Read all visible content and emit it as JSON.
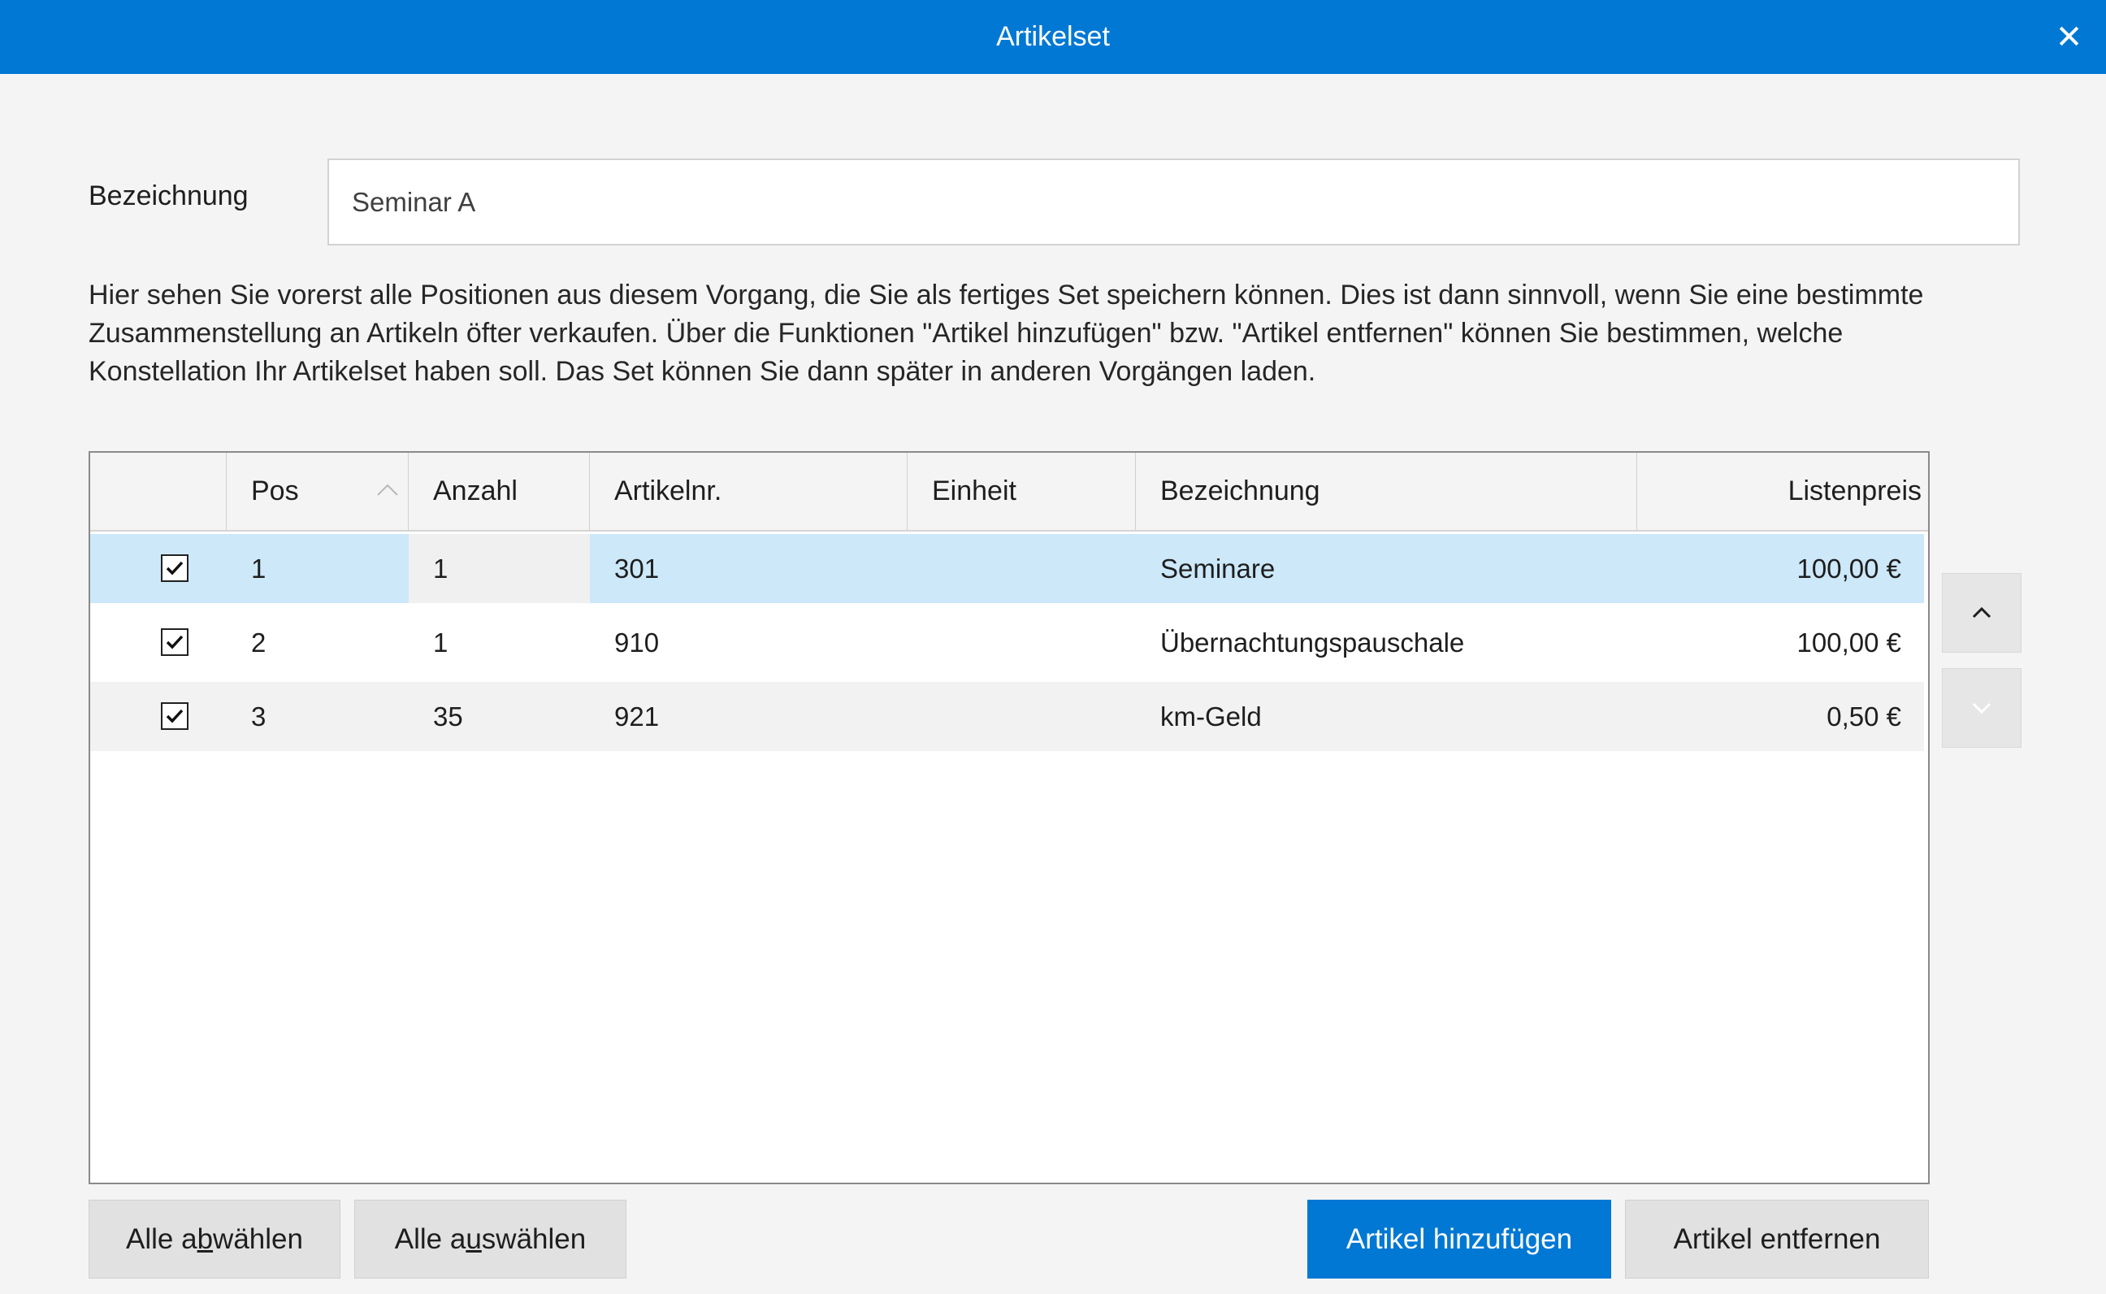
{
  "window": {
    "title": "Artikelset",
    "close_glyph": "✕"
  },
  "name_field": {
    "label": "Bezeichnung",
    "value": "Seminar A"
  },
  "description": "Hier sehen Sie vorerst alle Positionen aus diesem Vorgang, die Sie als fertiges Set speichern können. Dies ist dann sinnvoll, wenn Sie eine bestimmte Zusammenstellung an Artikeln öfter verkaufen. Über die Funktionen \"Artikel hinzufügen\" bzw. \"Artikel entfernen\" können Sie bestimmen, welche Konstellation Ihr Artikelset haben soll. Das Set können Sie dann später in anderen Vorgängen laden.",
  "table": {
    "columns": {
      "pos": "Pos",
      "anzahl": "Anzahl",
      "artikelnr": "Artikelnr.",
      "einheit": "Einheit",
      "bezeichnung": "Bezeichnung",
      "listenpreis": "Listenpreis"
    },
    "sort_column": "Pos",
    "sort_direction": "ascending",
    "rows": [
      {
        "checked": true,
        "pos": "1",
        "anzahl": "1",
        "artikelnr": "301",
        "einheit": "",
        "bezeichnung": "Seminare",
        "listenpreis": "100,00 €",
        "selected": true
      },
      {
        "checked": true,
        "pos": "2",
        "anzahl": "1",
        "artikelnr": "910",
        "einheit": "",
        "bezeichnung": "Übernachtungspauschale",
        "listenpreis": "100,00 €",
        "selected": false
      },
      {
        "checked": true,
        "pos": "3",
        "anzahl": "35",
        "artikelnr": "921",
        "einheit": "",
        "bezeichnung": "km-Geld",
        "listenpreis": "0,50 €",
        "selected": false
      }
    ]
  },
  "side_buttons": {
    "up_icon": "chevron-up-icon",
    "down_icon": "chevron-down-icon",
    "down_enabled": false
  },
  "buttons": {
    "deselect_all": {
      "pre": "Alle a",
      "key": "b",
      "post": "wählen"
    },
    "select_all": {
      "pre": "Alle a",
      "key": "u",
      "post": "swählen"
    },
    "add_article": "Artikel hinzufügen",
    "remove_article": "Artikel entfernen"
  },
  "colors": {
    "accent": "#0078d4",
    "selected_row": "#cce8f9",
    "selected_cell_focus": "#f0f0f0",
    "alt_row": "#f2f2f2"
  }
}
